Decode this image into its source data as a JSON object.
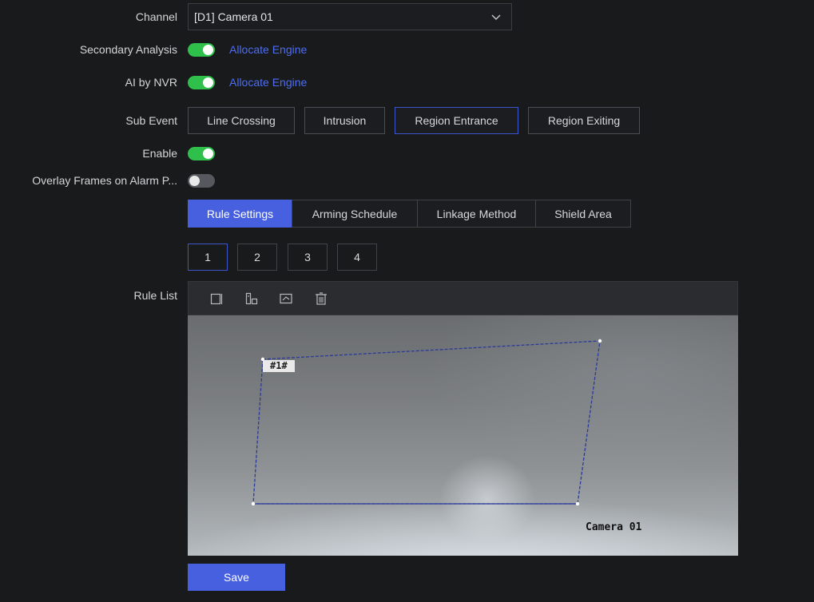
{
  "channel": {
    "label": "Channel",
    "value": "[D1] Camera 01"
  },
  "secondary_analysis": {
    "label": "Secondary Analysis",
    "on": true,
    "link": "Allocate Engine"
  },
  "ai_by_nvr": {
    "label": "AI by NVR",
    "on": true,
    "link": "Allocate Engine"
  },
  "sub_event": {
    "label": "Sub Event",
    "options": [
      "Line Crossing",
      "Intrusion",
      "Region Entrance",
      "Region Exiting"
    ],
    "selected": "Region Entrance"
  },
  "enable": {
    "label": "Enable",
    "on": true
  },
  "overlay": {
    "label": "Overlay Frames on Alarm P...",
    "on": false
  },
  "tabs": [
    "Rule Settings",
    "Arming Schedule",
    "Linkage Method",
    "Shield Area"
  ],
  "active_tab": "Rule Settings",
  "rule_numbers": [
    "1",
    "2",
    "3",
    "4"
  ],
  "selected_rule": "1",
  "rule_list": {
    "label": "Rule List",
    "tools": [
      "draw-area-icon",
      "auto-shape-icon",
      "clear-area-icon",
      "delete-icon"
    ]
  },
  "video": {
    "region_tag": "#1#",
    "osd_text": "Camera 01"
  },
  "save_label": "Save",
  "colors": {
    "accent": "#4760e0",
    "toggle_on": "#2ec04a",
    "link": "#4f6df0"
  }
}
